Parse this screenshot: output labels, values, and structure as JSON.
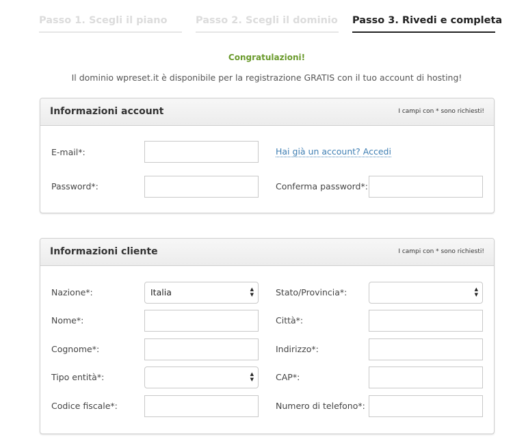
{
  "steps": [
    {
      "label": "Passo 1. Scegli il piano"
    },
    {
      "label": "Passo 2. Scegli il dominio"
    },
    {
      "label": "Passo 3. Rivedi e completa"
    }
  ],
  "congrats": "Congratulazioni!",
  "message": "Il dominio wpreset.it è disponibile per la registrazione GRATIS con il tuo account di hosting!",
  "account": {
    "title": "Informazioni account",
    "note": "I campi con * sono richiesti!",
    "email_label": "E-mail*:",
    "email_value": "",
    "login_link": "Hai già un account? Accedi",
    "password_label": "Password*:",
    "password_value": "",
    "confirm_label": "Conferma password*:",
    "confirm_value": ""
  },
  "customer": {
    "title": "Informazioni cliente",
    "note": "I campi con * sono richiesti!",
    "country_label": "Nazione*:",
    "country_value": "Italia",
    "state_label": "Stato/Provincia*:",
    "state_value": "",
    "name_label": "Nome*:",
    "city_label": "Città*:",
    "surname_label": "Cognome*:",
    "address_label": "Indirizzo*:",
    "entity_label": "Tipo entità*:",
    "entity_value": "",
    "zip_label": "CAP*:",
    "tax_label": "Codice fiscale*:",
    "phone_label": "Numero di telefono*:"
  }
}
